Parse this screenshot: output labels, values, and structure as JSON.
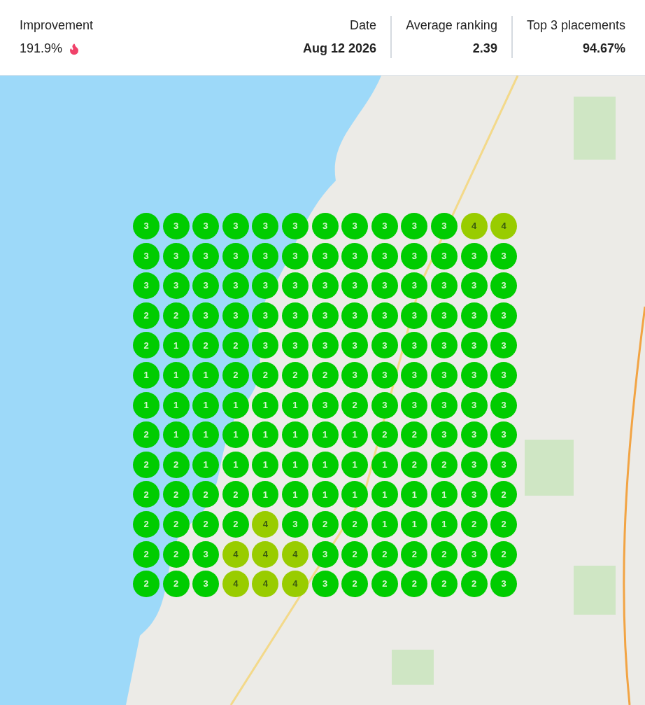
{
  "stats": {
    "improvement": {
      "label": "Improvement",
      "value": "191.9%"
    },
    "metrics": [
      {
        "label": "Date",
        "value": "Aug 12 2026"
      },
      {
        "label": "Average ranking",
        "value": "2.39"
      },
      {
        "label": "Top 3 placements",
        "value": "94.67%"
      }
    ]
  },
  "grid": [
    [
      {
        "rank": "3",
        "color": "#00cc00"
      },
      {
        "rank": "3",
        "color": "#00cc00"
      },
      {
        "rank": "3",
        "color": "#00cc00"
      },
      {
        "rank": "3",
        "color": "#00cc00"
      },
      {
        "rank": "3",
        "color": "#00cc00"
      },
      {
        "rank": "3",
        "color": "#00cc00"
      },
      {
        "rank": "3",
        "color": "#00cc00"
      },
      {
        "rank": "3",
        "color": "#00cc00"
      },
      {
        "rank": "3",
        "color": "#00cc00"
      },
      {
        "rank": "3",
        "color": "#00cc00"
      },
      {
        "rank": "3",
        "color": "#00cc00"
      },
      {
        "rank": "4",
        "color": "#99cc00"
      },
      {
        "rank": "4",
        "color": "#99cc00"
      }
    ],
    [
      {
        "rank": "3",
        "color": "#00cc00"
      },
      {
        "rank": "3",
        "color": "#00cc00"
      },
      {
        "rank": "3",
        "color": "#00cc00"
      },
      {
        "rank": "3",
        "color": "#00cc00"
      },
      {
        "rank": "3",
        "color": "#00cc00"
      },
      {
        "rank": "3",
        "color": "#00cc00"
      },
      {
        "rank": "3",
        "color": "#00cc00"
      },
      {
        "rank": "3",
        "color": "#00cc00"
      },
      {
        "rank": "3",
        "color": "#00cc00"
      },
      {
        "rank": "3",
        "color": "#00cc00"
      },
      {
        "rank": "3",
        "color": "#00cc00"
      },
      {
        "rank": "3",
        "color": "#00cc00"
      },
      {
        "rank": "3",
        "color": "#00cc00"
      }
    ],
    [
      {
        "rank": "3",
        "color": "#00cc00"
      },
      {
        "rank": "3",
        "color": "#00cc00"
      },
      {
        "rank": "3",
        "color": "#00cc00"
      },
      {
        "rank": "3",
        "color": "#00cc00"
      },
      {
        "rank": "3",
        "color": "#00cc00"
      },
      {
        "rank": "3",
        "color": "#00cc00"
      },
      {
        "rank": "3",
        "color": "#00cc00"
      },
      {
        "rank": "3",
        "color": "#00cc00"
      },
      {
        "rank": "3",
        "color": "#00cc00"
      },
      {
        "rank": "3",
        "color": "#00cc00"
      },
      {
        "rank": "3",
        "color": "#00cc00"
      },
      {
        "rank": "3",
        "color": "#00cc00"
      },
      {
        "rank": "3",
        "color": "#00cc00"
      }
    ],
    [
      {
        "rank": "2",
        "color": "#00cc00"
      },
      {
        "rank": "2",
        "color": "#00cc00"
      },
      {
        "rank": "3",
        "color": "#00cc00"
      },
      {
        "rank": "3",
        "color": "#00cc00"
      },
      {
        "rank": "3",
        "color": "#00cc00"
      },
      {
        "rank": "3",
        "color": "#00cc00"
      },
      {
        "rank": "3",
        "color": "#00cc00"
      },
      {
        "rank": "3",
        "color": "#00cc00"
      },
      {
        "rank": "3",
        "color": "#00cc00"
      },
      {
        "rank": "3",
        "color": "#00cc00"
      },
      {
        "rank": "3",
        "color": "#00cc00"
      },
      {
        "rank": "3",
        "color": "#00cc00"
      },
      {
        "rank": "3",
        "color": "#00cc00"
      }
    ],
    [
      {
        "rank": "2",
        "color": "#00cc00"
      },
      {
        "rank": "1",
        "color": "#00cc00"
      },
      {
        "rank": "2",
        "color": "#00cc00"
      },
      {
        "rank": "2",
        "color": "#00cc00"
      },
      {
        "rank": "3",
        "color": "#00cc00"
      },
      {
        "rank": "3",
        "color": "#00cc00"
      },
      {
        "rank": "3",
        "color": "#00cc00"
      },
      {
        "rank": "3",
        "color": "#00cc00"
      },
      {
        "rank": "3",
        "color": "#00cc00"
      },
      {
        "rank": "3",
        "color": "#00cc00"
      },
      {
        "rank": "3",
        "color": "#00cc00"
      },
      {
        "rank": "3",
        "color": "#00cc00"
      },
      {
        "rank": "3",
        "color": "#00cc00"
      }
    ],
    [
      {
        "rank": "1",
        "color": "#00cc00"
      },
      {
        "rank": "1",
        "color": "#00cc00"
      },
      {
        "rank": "1",
        "color": "#00cc00"
      },
      {
        "rank": "2",
        "color": "#00cc00"
      },
      {
        "rank": "2",
        "color": "#00cc00"
      },
      {
        "rank": "2",
        "color": "#00cc00"
      },
      {
        "rank": "2",
        "color": "#00cc00"
      },
      {
        "rank": "3",
        "color": "#00cc00"
      },
      {
        "rank": "3",
        "color": "#00cc00"
      },
      {
        "rank": "3",
        "color": "#00cc00"
      },
      {
        "rank": "3",
        "color": "#00cc00"
      },
      {
        "rank": "3",
        "color": "#00cc00"
      },
      {
        "rank": "3",
        "color": "#00cc00"
      }
    ],
    [
      {
        "rank": "1",
        "color": "#00cc00"
      },
      {
        "rank": "1",
        "color": "#00cc00"
      },
      {
        "rank": "1",
        "color": "#00cc00"
      },
      {
        "rank": "1",
        "color": "#00cc00"
      },
      {
        "rank": "1",
        "color": "#00cc00"
      },
      {
        "rank": "1",
        "color": "#00cc00"
      },
      {
        "rank": "3",
        "color": "#00cc00"
      },
      {
        "rank": "2",
        "color": "#00cc00"
      },
      {
        "rank": "3",
        "color": "#00cc00"
      },
      {
        "rank": "3",
        "color": "#00cc00"
      },
      {
        "rank": "3",
        "color": "#00cc00"
      },
      {
        "rank": "3",
        "color": "#00cc00"
      },
      {
        "rank": "3",
        "color": "#00cc00"
      }
    ],
    [
      {
        "rank": "2",
        "color": "#00cc00"
      },
      {
        "rank": "1",
        "color": "#00cc00"
      },
      {
        "rank": "1",
        "color": "#00cc00"
      },
      {
        "rank": "1",
        "color": "#00cc00"
      },
      {
        "rank": "1",
        "color": "#00cc00"
      },
      {
        "rank": "1",
        "color": "#00cc00"
      },
      {
        "rank": "1",
        "color": "#00cc00"
      },
      {
        "rank": "1",
        "color": "#00cc00"
      },
      {
        "rank": "2",
        "color": "#00cc00"
      },
      {
        "rank": "2",
        "color": "#00cc00"
      },
      {
        "rank": "3",
        "color": "#00cc00"
      },
      {
        "rank": "3",
        "color": "#00cc00"
      },
      {
        "rank": "3",
        "color": "#00cc00"
      }
    ],
    [
      {
        "rank": "2",
        "color": "#00cc00"
      },
      {
        "rank": "2",
        "color": "#00cc00"
      },
      {
        "rank": "1",
        "color": "#00cc00"
      },
      {
        "rank": "1",
        "color": "#00cc00"
      },
      {
        "rank": "1",
        "color": "#00cc00"
      },
      {
        "rank": "1",
        "color": "#00cc00"
      },
      {
        "rank": "1",
        "color": "#00cc00"
      },
      {
        "rank": "1",
        "color": "#00cc00"
      },
      {
        "rank": "1",
        "color": "#00cc00"
      },
      {
        "rank": "2",
        "color": "#00cc00"
      },
      {
        "rank": "2",
        "color": "#00cc00"
      },
      {
        "rank": "3",
        "color": "#00cc00"
      },
      {
        "rank": "3",
        "color": "#00cc00"
      }
    ],
    [
      {
        "rank": "2",
        "color": "#00cc00"
      },
      {
        "rank": "2",
        "color": "#00cc00"
      },
      {
        "rank": "2",
        "color": "#00cc00"
      },
      {
        "rank": "2",
        "color": "#00cc00"
      },
      {
        "rank": "1",
        "color": "#00cc00"
      },
      {
        "rank": "1",
        "color": "#00cc00"
      },
      {
        "rank": "1",
        "color": "#00cc00"
      },
      {
        "rank": "1",
        "color": "#00cc00"
      },
      {
        "rank": "1",
        "color": "#00cc00"
      },
      {
        "rank": "1",
        "color": "#00cc00"
      },
      {
        "rank": "1",
        "color": "#00cc00"
      },
      {
        "rank": "3",
        "color": "#00cc00"
      },
      {
        "rank": "2",
        "color": "#00cc00"
      }
    ],
    [
      {
        "rank": "2",
        "color": "#00cc00"
      },
      {
        "rank": "2",
        "color": "#00cc00"
      },
      {
        "rank": "2",
        "color": "#00cc00"
      },
      {
        "rank": "2",
        "color": "#00cc00"
      },
      {
        "rank": "4",
        "color": "#99cc00"
      },
      {
        "rank": "3",
        "color": "#00cc00"
      },
      {
        "rank": "2",
        "color": "#00cc00"
      },
      {
        "rank": "2",
        "color": "#00cc00"
      },
      {
        "rank": "1",
        "color": "#00cc00"
      },
      {
        "rank": "1",
        "color": "#00cc00"
      },
      {
        "rank": "1",
        "color": "#00cc00"
      },
      {
        "rank": "2",
        "color": "#00cc00"
      },
      {
        "rank": "2",
        "color": "#00cc00"
      }
    ],
    [
      {
        "rank": "2",
        "color": "#00cc00"
      },
      {
        "rank": "2",
        "color": "#00cc00"
      },
      {
        "rank": "3",
        "color": "#00cc00"
      },
      {
        "rank": "4",
        "color": "#99cc00"
      },
      {
        "rank": "4",
        "color": "#99cc00"
      },
      {
        "rank": "4",
        "color": "#99cc00"
      },
      {
        "rank": "3",
        "color": "#00cc00"
      },
      {
        "rank": "2",
        "color": "#00cc00"
      },
      {
        "rank": "2",
        "color": "#00cc00"
      },
      {
        "rank": "2",
        "color": "#00cc00"
      },
      {
        "rank": "2",
        "color": "#00cc00"
      },
      {
        "rank": "3",
        "color": "#00cc00"
      },
      {
        "rank": "2",
        "color": "#00cc00"
      }
    ],
    [
      {
        "rank": "2",
        "color": "#00cc00"
      },
      {
        "rank": "2",
        "color": "#00cc00"
      },
      {
        "rank": "3",
        "color": "#00cc00"
      },
      {
        "rank": "4",
        "color": "#99cc00"
      },
      {
        "rank": "4",
        "color": "#99cc00"
      },
      {
        "rank": "4",
        "color": "#99cc00"
      },
      {
        "rank": "3",
        "color": "#00cc00"
      },
      {
        "rank": "2",
        "color": "#00cc00"
      },
      {
        "rank": "2",
        "color": "#00cc00"
      },
      {
        "rank": "2",
        "color": "#00cc00"
      },
      {
        "rank": "2",
        "color": "#00cc00"
      },
      {
        "rank": "2",
        "color": "#00cc00"
      },
      {
        "rank": "3",
        "color": "#00cc00"
      }
    ]
  ]
}
